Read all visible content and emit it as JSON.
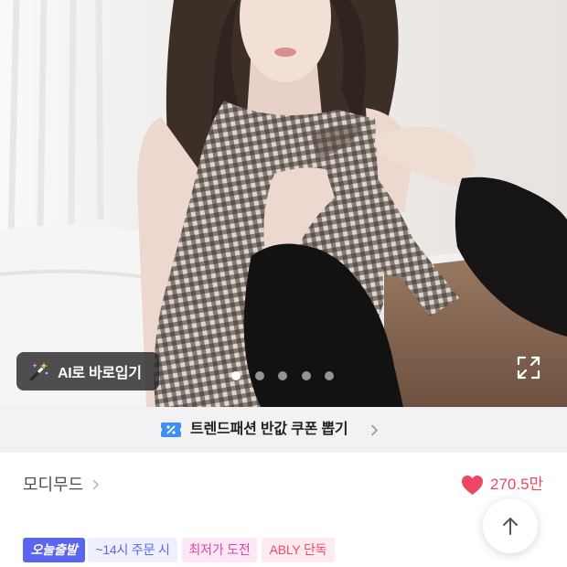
{
  "gallery": {
    "slide_count": 5,
    "active_index": 0,
    "ai_try_on": {
      "label": "AI로 바로입기",
      "icon": "magic-wand-icon"
    },
    "expand_icon": "expand-icon"
  },
  "coupon_banner": {
    "icon": "coupon-icon",
    "text": "트렌드패션 반값 쿠폰 뽑기",
    "chevron_icon": "chevron-right-icon"
  },
  "store": {
    "name": "모디무드",
    "chevron_icon": "chevron-right-icon"
  },
  "likes": {
    "icon": "heart-icon",
    "count": "270.5만"
  },
  "scroll_top": {
    "icon": "arrow-up-icon"
  },
  "badges": [
    {
      "label": "오늘출발",
      "bg": "#5b66f0",
      "fg": "#ffffff"
    },
    {
      "label": "~14시 주문 시",
      "bg": "#eef0ff",
      "fg": "#5b66f0"
    },
    {
      "label": "최저가 도전",
      "bg": "#fde6f5",
      "fg": "#e0479f"
    },
    {
      "label": "ABLY 단독",
      "bg": "#feeaef",
      "fg": "#ef4b6b"
    }
  ],
  "colors": {
    "like": "#ec4862",
    "banner_bg": "#f2f2f4",
    "coupon_icon": "#3f8ef2"
  }
}
